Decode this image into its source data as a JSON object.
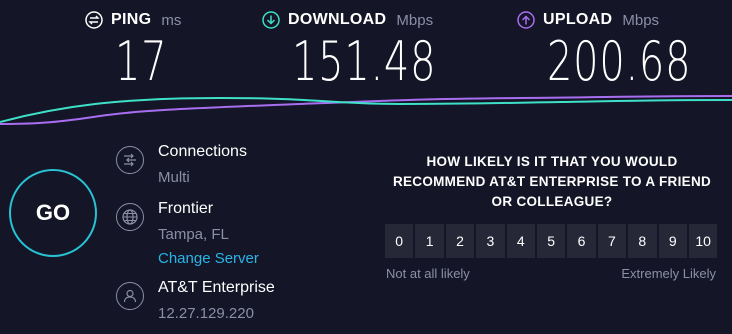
{
  "metrics": {
    "ping": {
      "label": "PING",
      "unit": "ms",
      "value": "17",
      "icon": "ping-icon",
      "color": "#ffffff"
    },
    "download": {
      "label": "DOWNLOAD",
      "unit": "Mbps",
      "value": "151.48",
      "icon": "download-arrow-icon",
      "color": "#3ee0c8"
    },
    "upload": {
      "label": "UPLOAD",
      "unit": "Mbps",
      "value": "200.68",
      "icon": "upload-arrow-icon",
      "color": "#a86ef0"
    }
  },
  "go_label": "GO",
  "connections": {
    "title": "Connections",
    "value": "Multi",
    "icon": "connections-icon"
  },
  "server": {
    "title": "Frontier",
    "location": "Tampa, FL",
    "change_label": "Change Server",
    "icon": "globe-icon"
  },
  "isp": {
    "title": "AT&T Enterprise",
    "ip": "12.27.129.220",
    "icon": "user-icon"
  },
  "survey": {
    "question": "HOW LIKELY IS IT THAT YOU WOULD RECOMMEND AT&T ENTERPRISE TO A FRIEND OR COLLEAGUE?",
    "scale": [
      "0",
      "1",
      "2",
      "3",
      "4",
      "5",
      "6",
      "7",
      "8",
      "9",
      "10"
    ],
    "low_label": "Not at all likely",
    "high_label": "Extremely Likely"
  },
  "colors": {
    "background": "#141526",
    "accent": "#27c3d4",
    "muted": "#8b8ea6",
    "link": "#27b5e8"
  }
}
